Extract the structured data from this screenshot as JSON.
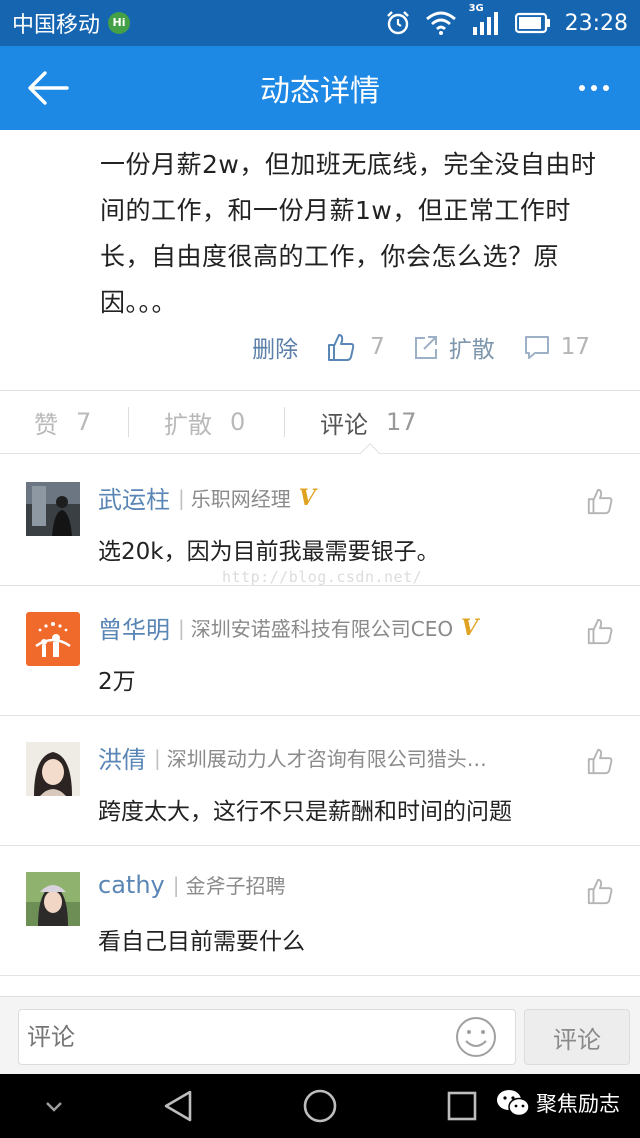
{
  "status_bar": {
    "carrier": "中国移动",
    "hd_badge": "Hi",
    "network": "3G",
    "time": "23:28"
  },
  "header": {
    "title": "动态详情"
  },
  "post": {
    "body": "一份月薪2w，但加班无底线，完全没自由时间的工作，和一份月薪1w，但正常工作时长，自由度很高的工作，你会怎么选？原因。。。",
    "delete_label": "删除",
    "like_count": "7",
    "share_label": "扩散",
    "comment_count": "17"
  },
  "tabs": [
    {
      "label": "赞",
      "count": "7"
    },
    {
      "label": "扩散",
      "count": "0"
    },
    {
      "label": "评论",
      "count": "17"
    }
  ],
  "comments": [
    {
      "name": "武运柱",
      "title": "乐职网经理",
      "verified": true,
      "text": "选20k，因为目前我最需要银子。"
    },
    {
      "name": "曾华明",
      "title": "深圳安诺盛科技有限公司CEO",
      "verified": true,
      "text": "2万"
    },
    {
      "name": "洪倩",
      "title": "深圳展动力人才咨询有限公司猎头…",
      "verified": false,
      "text": "跨度太大，这行不只是薪酬和时间的问题"
    },
    {
      "name": "cathy",
      "title": "金斧子招聘",
      "verified": false,
      "text": "看自己目前需要什么"
    }
  ],
  "watermark": "http://blog.csdn.net/",
  "input_bar": {
    "placeholder": "评论",
    "send_label": "评论"
  },
  "brand": {
    "label": "聚焦励志"
  },
  "colors": {
    "status_bar": "#1565b0",
    "header": "#1e88e5",
    "link": "#5a86b5",
    "verified_badge": "#e0a321"
  }
}
